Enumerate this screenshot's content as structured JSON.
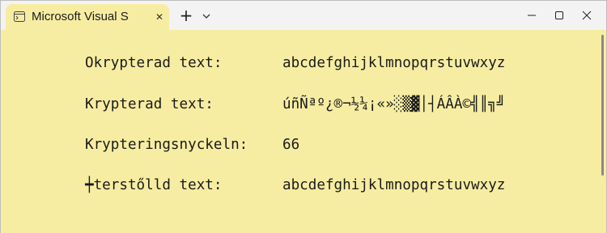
{
  "window": {
    "tab_title": "Microsoft Visual S",
    "tab_close_glyph": "✕",
    "new_tab_glyph": "+",
    "background_color": "#f7eda2"
  },
  "console": {
    "lines": [
      {
        "label": "Okrypterad text:",
        "value": "abcdefghijklmnopqrstuvwxyz"
      },
      {
        "label": "Krypterad text:",
        "value": "úñÑªº¿®¬½¼¡«»░▒▓│┤ÁÂÀ©╣║╗╝"
      },
      {
        "label": "Krypteringsnyckeln:",
        "value": "66"
      },
      {
        "label": "┿terstőlld text:",
        "value": "abcdefghijklmnopqrstuvwxyz"
      }
    ]
  }
}
